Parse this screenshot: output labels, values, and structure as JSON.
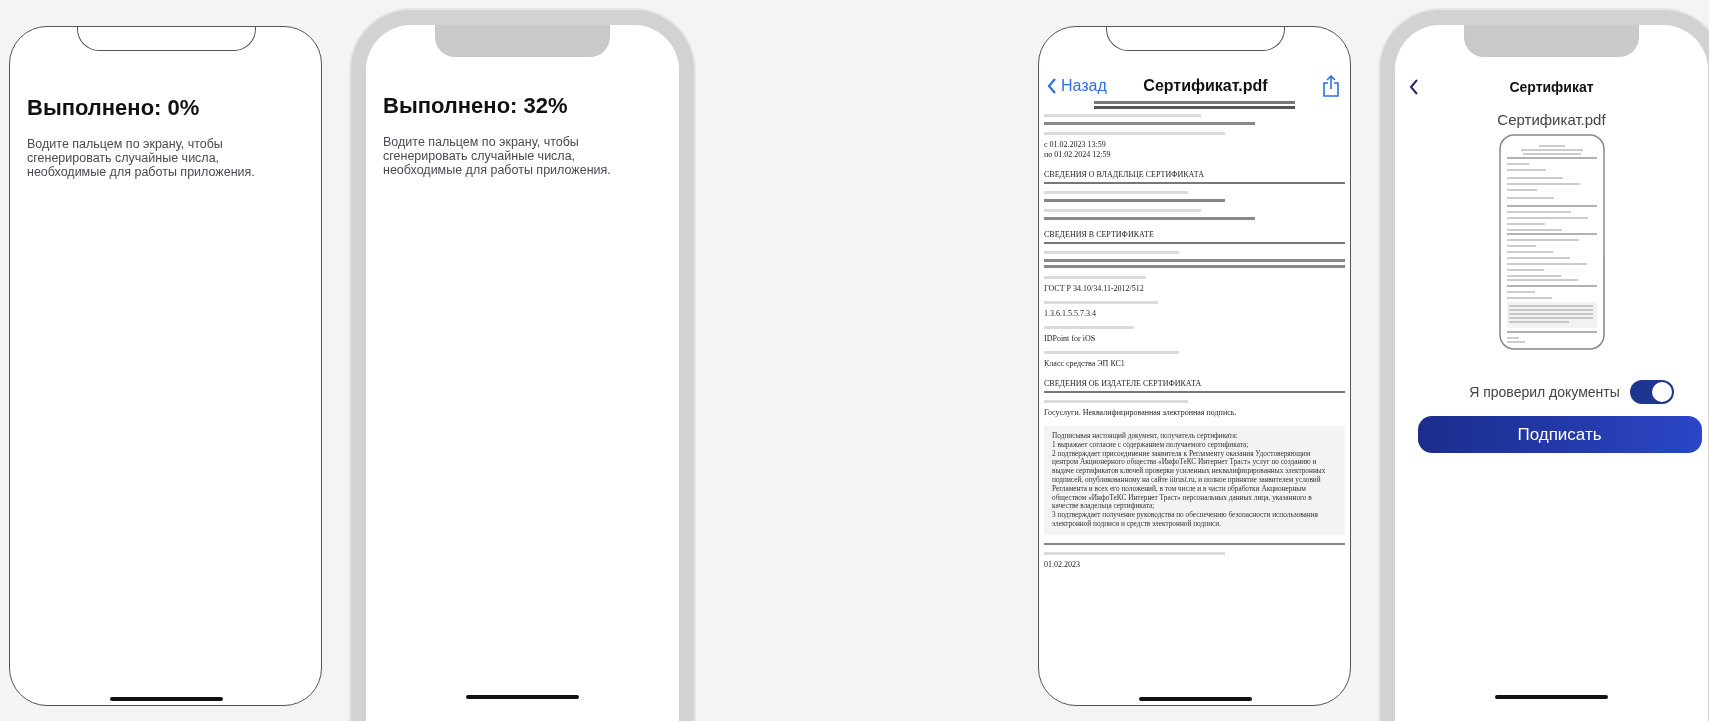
{
  "phones": [
    {
      "kind": "outline",
      "screen": {
        "kind": "progress",
        "title": "Выполнено: 0%",
        "description": "Водите пальцем по экрану, чтобы сгенерировать случайные числа, необходимые для работы приложения."
      }
    },
    {
      "kind": "bezel",
      "screen": {
        "kind": "progress",
        "title": "Выполнено: 32%",
        "description": "Водите пальцем по экрану, чтобы сгенерировать случайные числа, необходимые для работы приложения."
      }
    },
    {
      "kind": "outline",
      "screen": {
        "kind": "pdf-viewer",
        "back": "Назад",
        "title": "Сертификат.pdf",
        "document": [
          {
            "kind": "cut-title"
          },
          {
            "kind": "label-lines"
          },
          {
            "kind": "value-lines"
          },
          {
            "kind": "label-lines"
          },
          {
            "kind": "value",
            "text": "с 01.02.2023 13:59"
          },
          {
            "kind": "value",
            "text": "по 01.02.2024 12:59"
          },
          {
            "kind": "heading",
            "text": "СВЕДЕНИЯ О ВЛАДЕЛЬЦЕ СЕРТИФИКАТА"
          },
          {
            "kind": "label-lines"
          },
          {
            "kind": "value-lines"
          },
          {
            "kind": "label-lines"
          },
          {
            "kind": "value-lines"
          },
          {
            "kind": "heading",
            "text": "СВЕДЕНИЯ В СЕРТИФИКАТЕ"
          },
          {
            "kind": "label-lines"
          },
          {
            "kind": "hex-lines"
          },
          {
            "kind": "label-lines"
          },
          {
            "kind": "value",
            "text": "ГОСТ Р 34.10/34.11-2012/512"
          },
          {
            "kind": "label-lines"
          },
          {
            "kind": "value",
            "text": "1.3.6.1.5.5.7.3.4"
          },
          {
            "kind": "label-lines"
          },
          {
            "kind": "value",
            "text": "IDPoint for iOS"
          },
          {
            "kind": "label-lines"
          },
          {
            "kind": "value",
            "text": "Класс средства ЭП КС1"
          },
          {
            "kind": "heading",
            "text": "СВЕДЕНИЯ ОБ ИЗДАТЕЛЕ СЕРТИФИКАТА"
          },
          {
            "kind": "label-lines"
          },
          {
            "kind": "value",
            "text": "Госуслуги. Неквалифицированная электронная подпись."
          },
          {
            "kind": "notice",
            "paragraphs": [
              "Подписывая настоящий документ, получатель сертификата:",
              "1 выражает согласие с содержанием получаемого сертификата;",
              "2 подтверждает присоединение заявителя к Регламенту оказания Удостоверяющим центром Акционерного общества «ИнфоТеКС Интернет Траст» услуг по созданию и выдаче сертификатов ключей проверки усиленных неквалифицированных электронных подписей, опубликованному на сайте iitrust.ru, и полное принятие заявителем условий Регламента и всех его положений, в том числе и в части обработки Акционерным обществом «ИнфоТеКС Интернет Траст» персональных данных лица, указанного в качестве владельца сертификата;",
              "3 подтверждает получение руководства по обеспечению безопасности использования электронной подписи и средств электронной подписи."
            ]
          },
          {
            "kind": "rule"
          },
          {
            "kind": "label-lines"
          },
          {
            "kind": "value",
            "text": "01.02.2023"
          }
        ]
      }
    },
    {
      "kind": "bezel",
      "screen": {
        "kind": "sign",
        "title": "Сертификат",
        "file_name": "Сертификат.pdf",
        "confirm": {
          "label": "Я проверил документы",
          "on": true
        },
        "button": "Подписать"
      }
    }
  ]
}
